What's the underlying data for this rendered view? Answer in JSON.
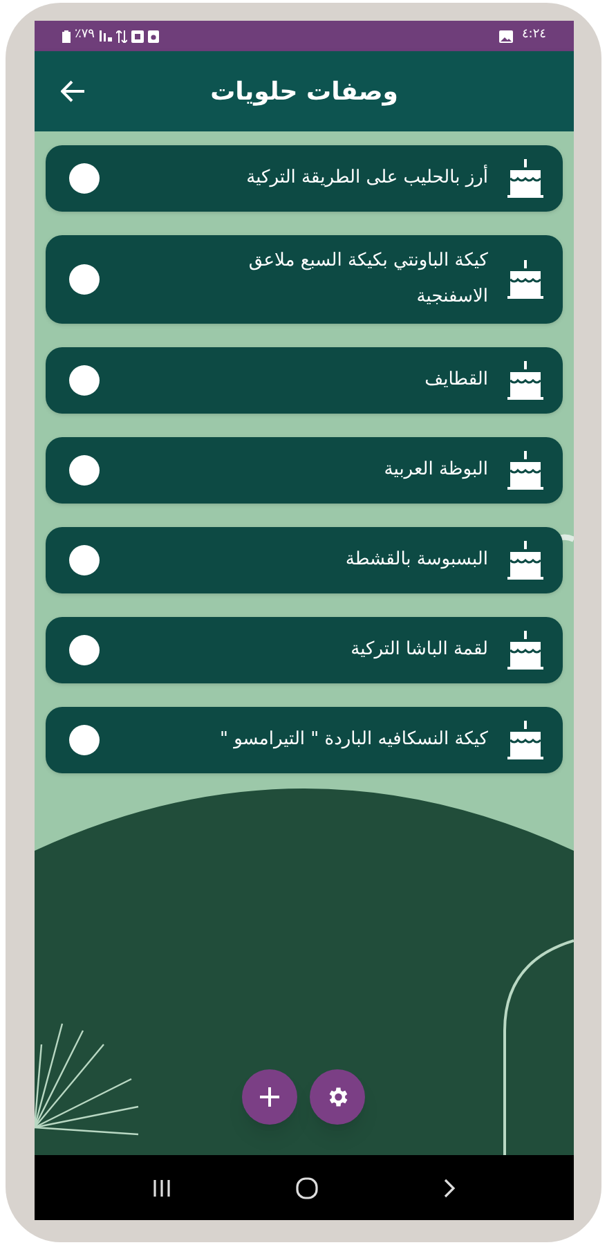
{
  "status_bar": {
    "battery": "٪٧٩",
    "time": "٤:٢٤"
  },
  "header": {
    "title": "وصفات حلويات"
  },
  "recipes": [
    {
      "title": "أرز بالحليب على الطريقة التركية",
      "selected": false
    },
    {
      "title": "كيكة الباونتي بكيكة السبع ملاعق الاسفنجية",
      "selected": false
    },
    {
      "title": "القطايف",
      "selected": false
    },
    {
      "title": "البوظة العربية",
      "selected": false
    },
    {
      "title": "البسبوسة بالقشطة",
      "selected": false
    },
    {
      "title": "لقمة الباشا التركية",
      "selected": false
    },
    {
      "title": "كيكة النسكافيه الباردة \" التيرامسو \"",
      "selected": false
    }
  ]
}
